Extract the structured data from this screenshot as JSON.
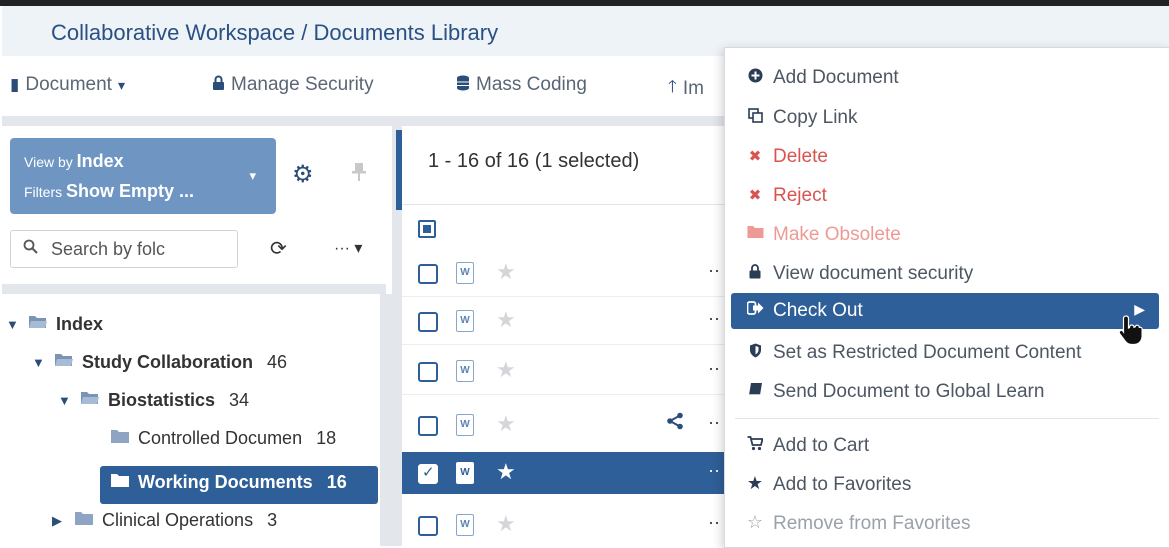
{
  "title": "Collaborative Workspace / Documents Library",
  "toolbar": {
    "document_label": "Document",
    "document_caret": "▾",
    "manage_security_label": "Manage Security",
    "mass_coding_label": "Mass Coding",
    "import_label": "Im"
  },
  "view_panel": {
    "view_by_prefix": "View by",
    "view_by_value": "Index",
    "filters_prefix": "Filters",
    "filters_value": "Show Empty ...",
    "caret": "▾"
  },
  "folder_search": {
    "placeholder": "Search by folc",
    "more_label": "··· ▾"
  },
  "tree": [
    {
      "label": "Index",
      "count": "",
      "expanded": true
    },
    {
      "label": "Study Collaboration",
      "count": "46",
      "expanded": true
    },
    {
      "label": "Biostatistics",
      "count": "34",
      "expanded": true
    },
    {
      "label": "Controlled Documen",
      "count": "18"
    },
    {
      "label": "Working Documents",
      "count": "16",
      "selected": true
    },
    {
      "label": "Clinical Operations",
      "count": "3",
      "expanded": false
    }
  ],
  "list": {
    "count_text": "1 - 16 of 16 (1 selected)",
    "more_label": "··",
    "doc_icon_letter": "W"
  },
  "context_menu": {
    "items": [
      {
        "label": "Add Document",
        "icon": "plus-circle-icon"
      },
      {
        "label": "Copy Link",
        "icon": "copy-icon"
      },
      {
        "label": "Delete",
        "icon": "x-icon"
      },
      {
        "label": "Reject",
        "icon": "x-icon"
      },
      {
        "label": "Make Obsolete",
        "icon": "folder-icon"
      },
      {
        "label": "View document security",
        "icon": "lock-icon"
      },
      {
        "label": "Check Out",
        "icon": "sign-out-icon"
      },
      {
        "label": "Set as Restricted Document Content",
        "icon": "shield-icon"
      },
      {
        "label": "Send Document to Global Learn",
        "icon": "book-icon"
      },
      {
        "label": "Add to Cart",
        "icon": "cart-icon"
      },
      {
        "label": "Add to Favorites",
        "icon": "star-icon"
      },
      {
        "label": "Remove from Favorites",
        "icon": "star-outline-icon"
      }
    ]
  },
  "colors": {
    "primary": "#2f5f98",
    "title": "#2a5183",
    "view_box": "#6f96c3",
    "danger": "#d9534f",
    "muted_danger": "#ee9a94"
  }
}
